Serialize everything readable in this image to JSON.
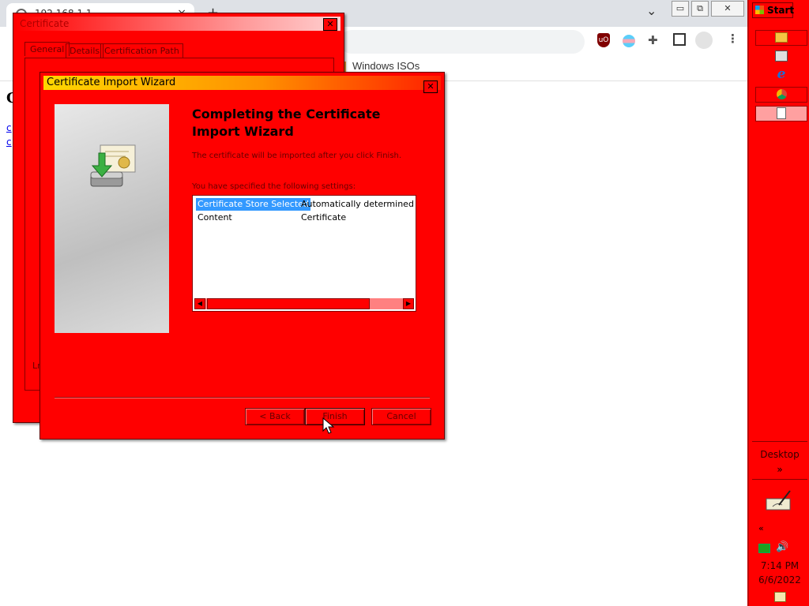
{
  "browser": {
    "tab_title": "192.168.1.1",
    "tab_close": "×",
    "new_tab": "+",
    "bookmark": "Windows ISOs",
    "win_min": "▭",
    "win_restore": "⧉",
    "win_close": "✕",
    "tab_menu": "⌄"
  },
  "page": {
    "heading": "C",
    "links": [
      "c",
      "c"
    ]
  },
  "cert_dialog": {
    "title": "Certificate",
    "tabs": [
      "General",
      "Details",
      "Certification Path"
    ],
    "fragment": "Lr"
  },
  "wizard": {
    "title": "Certificate Import Wizard",
    "heading": "Completing the Certificate Import Wizard",
    "note": "The certificate will be imported after you click Finish.",
    "settings_label": "You have specified the following settings:",
    "settings": [
      {
        "name": "Certificate Store Selected",
        "value": "Automatically determined by t"
      },
      {
        "name": "Content",
        "value": "Certificate"
      }
    ],
    "back_label": "< Back",
    "finish_label": "Finish",
    "cancel_label": "Cancel"
  },
  "taskbar": {
    "start_label": "Start",
    "desktop_label": "Desktop",
    "expand": "»",
    "collapse": "«",
    "time": "7:14 PM",
    "date": "6/6/2022"
  },
  "colors": {
    "theme": "#ff0000",
    "selection": "#3399ff"
  }
}
